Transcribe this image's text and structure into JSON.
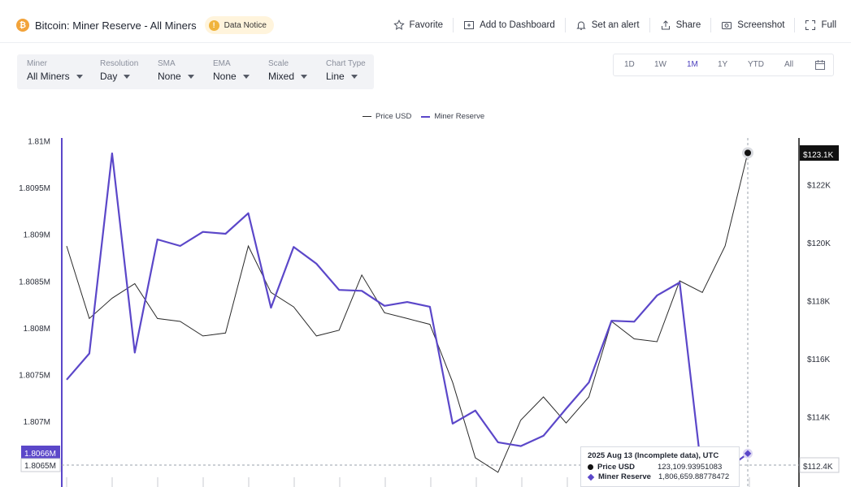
{
  "header": {
    "title": "Bitcoin: Miner Reserve - All Miners",
    "notice": "Data Notice",
    "actions": {
      "favorite": "Favorite",
      "dashboard": "Add to Dashboard",
      "alert": "Set an alert",
      "share": "Share",
      "screenshot": "Screenshot",
      "full": "Full"
    }
  },
  "controls": [
    {
      "label": "Miner",
      "value": "All Miners"
    },
    {
      "label": "Resolution",
      "value": "Day"
    },
    {
      "label": "SMA",
      "value": "None"
    },
    {
      "label": "EMA",
      "value": "None"
    },
    {
      "label": "Scale",
      "value": "Mixed"
    },
    {
      "label": "Chart Type",
      "value": "Line"
    }
  ],
  "ranges": [
    "1D",
    "1W",
    "1M",
    "1Y",
    "YTD",
    "All"
  ],
  "active_range": "1M",
  "colors": {
    "price": "#2a2a2a",
    "reserve": "#5b47c9",
    "accent": "#4b3fbd",
    "price_badge_bg": "#111111",
    "reserve_badge_bg": "#5b47c9"
  },
  "tooltip": {
    "title": "2025 Aug 13 (Incomplete data), UTC",
    "price_label": "Price USD",
    "price_value": "123,109.93951083",
    "reserve_label": "Miner Reserve",
    "reserve_value": "1,806,659.88778472"
  },
  "chart_data": {
    "type": "line",
    "legend": [
      "Price USD",
      "Miner Reserve"
    ],
    "legend_position": "top-center",
    "grid": false,
    "x": [
      1,
      2,
      3,
      4,
      5,
      6,
      7,
      8,
      9,
      10,
      11,
      12,
      13,
      14,
      15,
      16,
      17,
      18,
      19,
      20,
      21,
      22,
      23,
      24,
      25,
      26,
      27,
      28,
      29,
      30,
      31
    ],
    "series": [
      {
        "name": "Miner Reserve",
        "axis": "left",
        "values": [
          1807450,
          1807730,
          1809870,
          1807740,
          1808950,
          1808880,
          1809030,
          1809010,
          1809230,
          1808220,
          1808870,
          1808690,
          1808410,
          1808400,
          1808240,
          1808280,
          1808230,
          1806980,
          1807120,
          1806780,
          1806740,
          1806850,
          1807140,
          1807420,
          1808080,
          1808070,
          1808350,
          1808490,
          1806400,
          1806480,
          1806660
        ]
      },
      {
        "name": "Price USD",
        "axis": "right",
        "values": [
          119900,
          117400,
          118100,
          118600,
          117400,
          117300,
          116800,
          116900,
          119900,
          118300,
          117800,
          116800,
          117000,
          118900,
          117600,
          117400,
          117200,
          115200,
          112600,
          112100,
          113900,
          114700,
          113800,
          114700,
          117300,
          116700,
          116600,
          118700,
          118300,
          119900,
          123110
        ]
      }
    ],
    "y_left": {
      "ticks": [
        "1.81M",
        "1.8095M",
        "1.809M",
        "1.8085M",
        "1.808M",
        "1.8075M",
        "1.807M",
        "1.8065M"
      ],
      "range": [
        1806500,
        1810000
      ]
    },
    "y_right": {
      "ticks": [
        "$122K",
        "$120K",
        "$118K",
        "$116K",
        "$114K"
      ],
      "range": [
        111300,
        126000
      ]
    },
    "badges": {
      "left_reserve": "1.8066M",
      "left_cross": "1.8065M",
      "right_price": "$123.1K",
      "right_cross": "$112.4K"
    }
  }
}
